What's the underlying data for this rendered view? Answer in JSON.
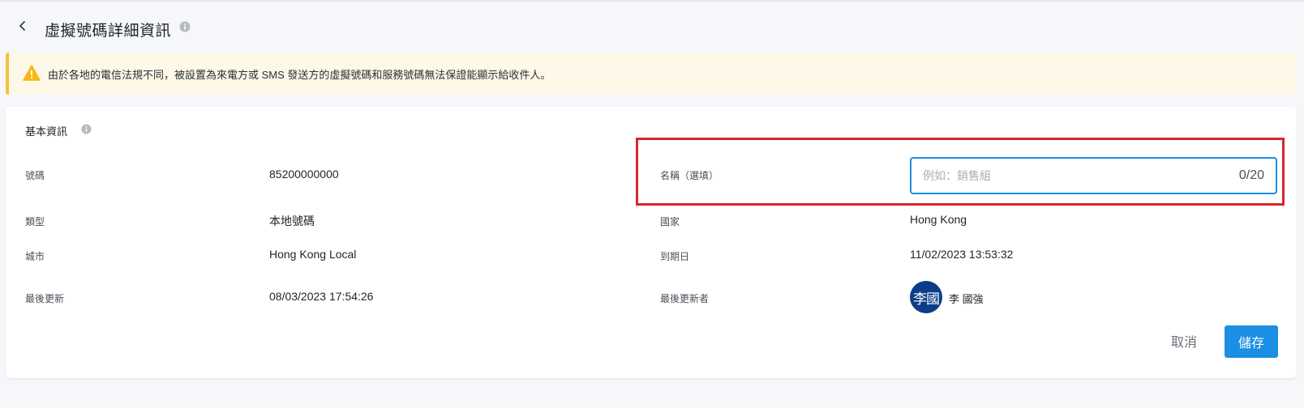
{
  "header": {
    "title": "虛擬號碼詳細資訊"
  },
  "alert": {
    "text": "由於各地的電信法規不同，被設置為來電方或 SMS 發送方的虛擬號碼和服務號碼無法保證能顯示給收件人。"
  },
  "basic_info": {
    "section_title": "基本資訊",
    "number": {
      "label": "號碼",
      "value": "85200000000"
    },
    "type": {
      "label": "類型",
      "value": "本地號碼"
    },
    "city": {
      "label": "城市",
      "value": "Hong Kong Local"
    },
    "last_updated": {
      "label": "最後更新",
      "value": "08/03/2023 17:54:26"
    },
    "name": {
      "label": "名稱（選填）",
      "placeholder": "例如：銷售組",
      "value": "",
      "counter": "0/20"
    },
    "country": {
      "label": "國家",
      "value": "Hong Kong"
    },
    "expiry": {
      "label": "到期日",
      "value": "11/02/2023 13:53:32"
    },
    "last_updated_by": {
      "label": "最後更新者",
      "avatar_text": "李國",
      "value": "李 國強"
    }
  },
  "actions": {
    "cancel_label": "取消",
    "save_label": "儲存"
  },
  "colors": {
    "primary": "#1a8fe3",
    "highlight": "#d9262e",
    "alert_bg": "#fdf8e8",
    "alert_accent": "#f5c23b",
    "avatar_bg": "#0c3d87"
  }
}
